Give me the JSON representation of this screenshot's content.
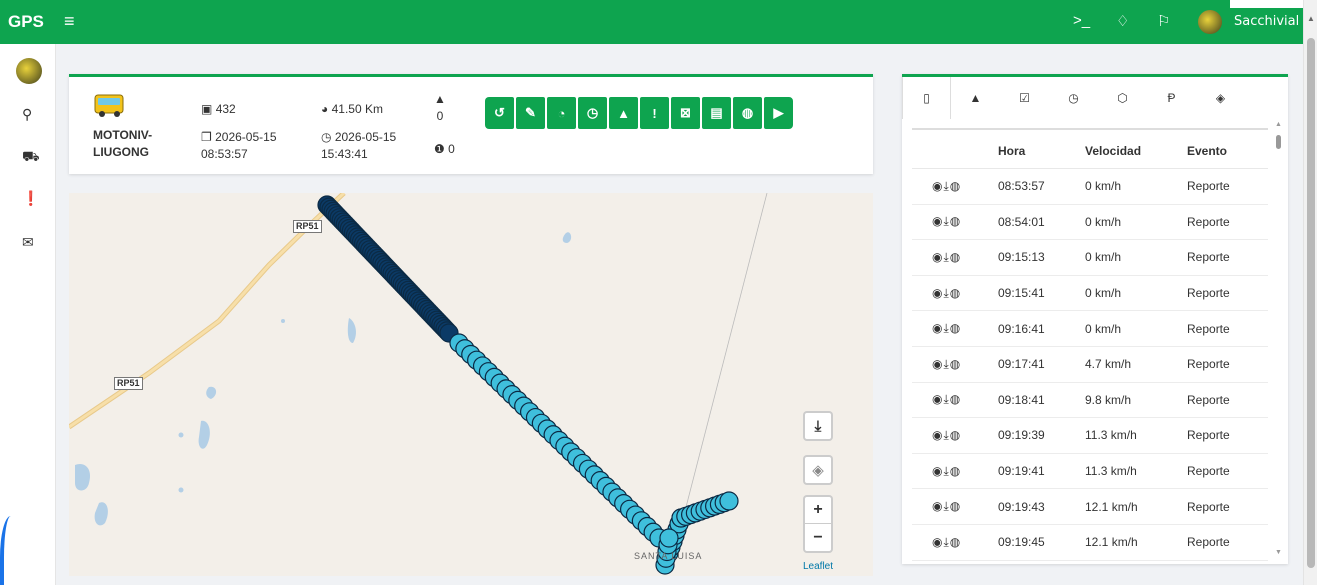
{
  "topbar": {
    "brand": "GPS",
    "menu_icon": "hamburger-icon",
    "icons": [
      "terminal-icon",
      "bell-icon",
      "flag-icon"
    ],
    "user_name": "Sacchivial"
  },
  "sidebar": {
    "items": [
      "map-marker-icon",
      "car-icon",
      "alert-icon",
      "envelope-icon"
    ]
  },
  "vehicle": {
    "name": "MOTONIV-\nLIUGONG",
    "count": "432",
    "distance": "41.50 Km",
    "start_date": "2026-05-15",
    "start_time": "08:53:57",
    "end_date": "2026-05-15",
    "end_time": "15:43:41",
    "alerts": "0",
    "warnings": "0"
  },
  "action_buttons": [
    {
      "icon": "history-icon",
      "glyph": "↺"
    },
    {
      "icon": "edit-icon",
      "glyph": "✎"
    },
    {
      "icon": "speedometer-icon",
      "glyph": "◔"
    },
    {
      "icon": "clock-icon",
      "glyph": "◷"
    },
    {
      "icon": "warning-icon",
      "glyph": "▲"
    },
    {
      "icon": "exclamation-icon",
      "glyph": "!"
    },
    {
      "icon": "excel-icon",
      "glyph": "⊠"
    },
    {
      "icon": "file-icon",
      "glyph": "▤"
    },
    {
      "icon": "globe-icon",
      "glyph": "◍"
    },
    {
      "icon": "play-icon",
      "glyph": "▶"
    }
  ],
  "map": {
    "road_label_1": "RP51",
    "road_label_2": "RP51",
    "place_label": "SANTA LUISA",
    "attribution": "Leaflet",
    "zoom_in": "+",
    "zoom_out": "−"
  },
  "panel": {
    "tabs": [
      "file-icon",
      "bell-icon",
      "check-square-icon",
      "clock-icon",
      "gear-icon",
      "flag-icon",
      "eye-slash-icon"
    ],
    "tab_glyphs": [
      "▯",
      "▲",
      "☑",
      "◷",
      "⬡",
      "Ᵽ",
      "◈"
    ],
    "columns": [
      "",
      "Hora",
      "Velocidad",
      "Evento"
    ],
    "rows": [
      {
        "hora": "08:53:57",
        "velocidad": "0 km/h",
        "evento": "Reporte"
      },
      {
        "hora": "08:54:01",
        "velocidad": "0 km/h",
        "evento": "Reporte"
      },
      {
        "hora": "09:15:13",
        "velocidad": "0 km/h",
        "evento": "Reporte"
      },
      {
        "hora": "09:15:41",
        "velocidad": "0 km/h",
        "evento": "Reporte"
      },
      {
        "hora": "09:16:41",
        "velocidad": "0 km/h",
        "evento": "Reporte"
      },
      {
        "hora": "09:17:41",
        "velocidad": "4.7 km/h",
        "evento": "Reporte"
      },
      {
        "hora": "09:18:41",
        "velocidad": "9.8 km/h",
        "evento": "Reporte"
      },
      {
        "hora": "09:19:39",
        "velocidad": "11.3 km/h",
        "evento": "Reporte"
      },
      {
        "hora": "09:19:41",
        "velocidad": "11.3 km/h",
        "evento": "Reporte"
      },
      {
        "hora": "09:19:43",
        "velocidad": "12.1 km/h",
        "evento": "Reporte"
      },
      {
        "hora": "09:19:45",
        "velocidad": "12.1 km/h",
        "evento": "Reporte"
      }
    ]
  },
  "colors": {
    "brand_green": "#0ea44f",
    "marker_dark": "#0b3a66",
    "marker_light": "#3fbfdc"
  }
}
